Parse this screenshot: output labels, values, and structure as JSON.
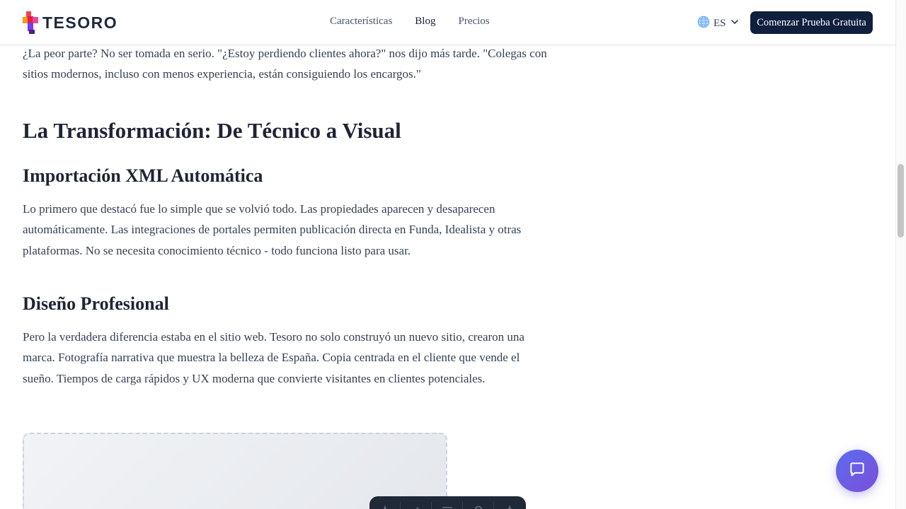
{
  "brand": {
    "name": "TESORO"
  },
  "nav": {
    "items": [
      {
        "label": "Características",
        "active": false
      },
      {
        "label": "Blog",
        "active": true
      },
      {
        "label": "Precios",
        "active": false
      }
    ]
  },
  "language": {
    "code": "ES",
    "icon": "globe-icon"
  },
  "cta": {
    "label": "Comenzar Prueba Gratuita"
  },
  "article": {
    "intro_paragraph": "¿La peor parte? No ser tomada en serio. \"¿Estoy perdiendo clientes ahora?\" nos dijo más tarde. \"Colegas con sitios modernos, incluso con menos experiencia, están consiguiendo los encargos.\"",
    "section_heading": "La Transformación: De Técnico a Visual",
    "sub1_heading": "Importación XML Automática",
    "sub1_paragraph": "Lo primero que destacó fue lo simple que se volvió todo. Las propiedades aparecen y desaparecen automáticamente. Las integraciones de portales permiten publicación directa en Funda, Idealista y otras plataformas. No se necesita conocimiento técnico - todo funciona listo para usar.",
    "sub2_heading": "Diseño Profesional",
    "sub2_paragraph": "Pero la verdadera diferencia estaba en el sitio web. Tesoro no solo construyó un nuevo sitio, crearon una marca. Fotografía narrativa que muestra la belleza de España. Copia centrada en el cliente que vende el sueño. Tiempos de carga rápidos y UX moderna que convierte visitantes en clientes potenciales."
  },
  "colors": {
    "brand_navy": "#0f1f3d",
    "body_text": "#334155",
    "heading_text": "#1e2433",
    "chat_gradient_start": "#5b6cf0",
    "chat_gradient_end": "#7c4fd8"
  },
  "icons": {
    "chat": "chat-bubble-icon",
    "toolbar": [
      "text-icon",
      "brush-icon",
      "align-icon",
      "location-icon",
      "settings-icon"
    ]
  }
}
